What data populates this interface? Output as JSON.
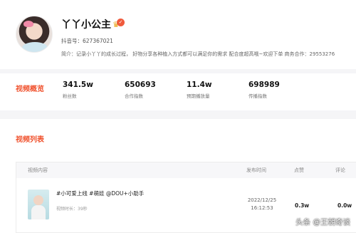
{
  "profile": {
    "nickname": "丫丫小公主",
    "crown_icon": "crown-icon",
    "verified_icon": "verified-badge-icon",
    "douyin_id": "抖音号：627367021",
    "bio": "简介：记录小丫丫的成长过程， 好物分享各种植入方式都可以满足你的需求 配合度超高哦~欢迎下单 商务合作：29553276"
  },
  "overview": {
    "title": "视频概览",
    "stats": [
      {
        "value": "341.5w",
        "label": "粉丝数"
      },
      {
        "value": "650693",
        "label": "合作指数"
      },
      {
        "value": "11.4w",
        "label": "预期播放量"
      },
      {
        "value": "698989",
        "label": "传播指数"
      }
    ]
  },
  "video_list": {
    "title": "视频列表",
    "columns": {
      "content": "视频内容",
      "publish_time": "发布时间",
      "likes": "点赞",
      "comments": "评论"
    },
    "rows": [
      {
        "title": "#小可爱上线 #萌娃 @DOU+小助手",
        "duration": "视频时长：39秒",
        "publish_date": "2022/12/25",
        "publish_time": "16:12:53",
        "likes": "0.3w",
        "comments": "0.0w"
      }
    ]
  },
  "watermark": "头条 @王朝奇谈",
  "colors": {
    "accent": "#f0522e",
    "background": "#f5f5f7"
  }
}
